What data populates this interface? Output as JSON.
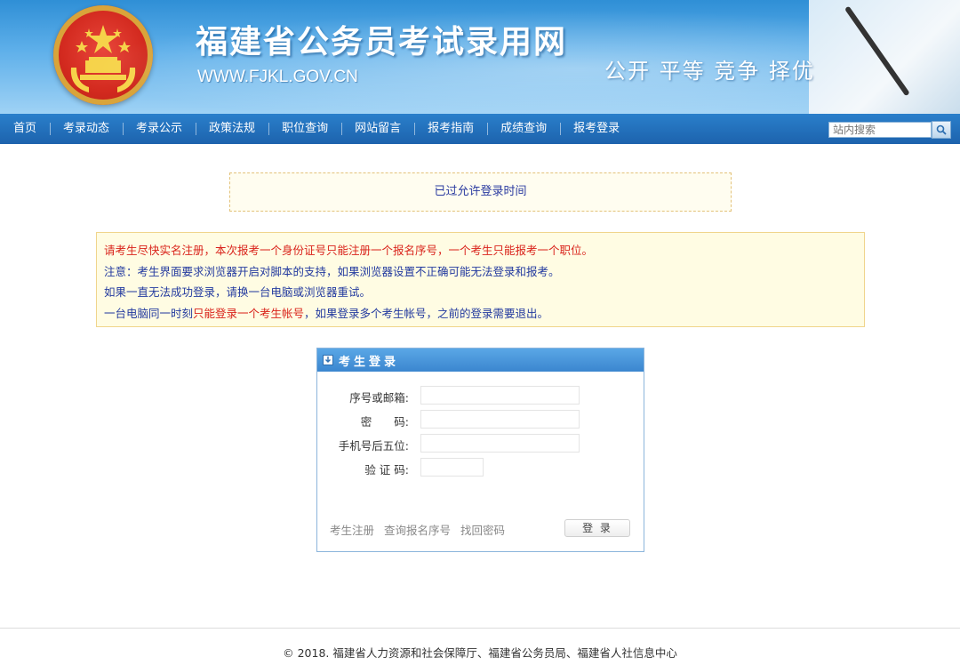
{
  "header": {
    "title": "福建省公务员考试录用网",
    "url": "WWW.FJKL.GOV.CN",
    "slogan": "公开  平等  竞争  择优"
  },
  "nav": {
    "items": [
      "首页",
      "考录动态",
      "考录公示",
      "政策法规",
      "职位查询",
      "网站留言",
      "报考指南",
      "成绩查询",
      "报考登录"
    ],
    "search_placeholder": "站内搜索"
  },
  "notice": {
    "top": "已过允许登录时间",
    "lines": [
      {
        "text": "请考生尽快实名注册，本次报考一个身份证号只能注册一个报名序号，一个考生只能报考一个职位。",
        "color": "#d9231b"
      },
      {
        "text": "注意：考生界面要求浏览器开启对脚本的支持，如果浏览器设置不正确可能无法登录和报考。",
        "color": "#233a9f"
      },
      {
        "text": "如果一直无法成功登录，请换一台电脑或浏览器重试。",
        "color": "#233a9f"
      }
    ],
    "last_line": {
      "part1": "一台电脑同一时刻",
      "part2": "只能登录一个考生帐号",
      "part3": "，如果登录多个考生帐号，之前的登录需要退出。"
    }
  },
  "login": {
    "title": "考生登录",
    "fields": [
      {
        "label": "序号或邮箱:",
        "value": ""
      },
      {
        "label": "密　　码:",
        "value": ""
      },
      {
        "label": "手机号后五位:",
        "value": ""
      },
      {
        "label": "验 证 码:",
        "value": ""
      }
    ],
    "links": [
      "考生注册",
      "查询报名序号",
      "找回密码"
    ],
    "submit_label": "登 录"
  },
  "footer": {
    "copyright": "© 2018. 福建省人力资源和社会保障厅、福建省公务员局、福建省人社信息中心"
  },
  "colors": {
    "nav_bg": "#1d63ad",
    "red_text": "#d9231b",
    "blue_text": "#233a9f",
    "panel_header": "#3b86cf"
  }
}
